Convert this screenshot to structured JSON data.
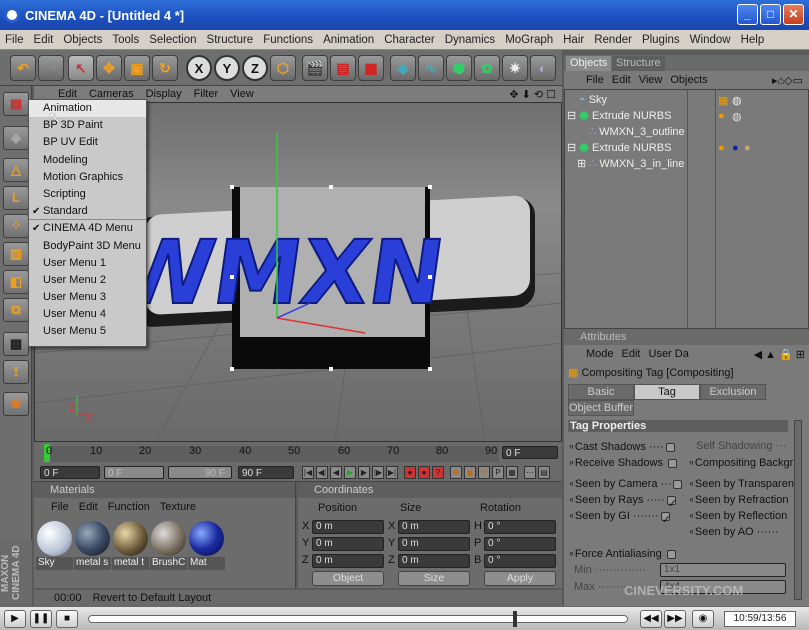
{
  "window": {
    "title": "CINEMA 4D - [Untitled 4 *]",
    "min": "_",
    "max": "□",
    "close": "✕"
  },
  "menubar": [
    "File",
    "Edit",
    "Objects",
    "Tools",
    "Selection",
    "Structure",
    "Functions",
    "Animation",
    "Character",
    "Dynamics",
    "MoGraph",
    "Hair",
    "Render",
    "Plugins",
    "Window",
    "Help"
  ],
  "viewport_menu": [
    "Edit",
    "Cameras",
    "Display",
    "Filter",
    "View"
  ],
  "viewport_nav": "✥ ⬇ ⟲ ☐",
  "dropdown": {
    "items": [
      {
        "label": "Animation",
        "checked": false,
        "highlighted": true
      },
      {
        "label": "BP 3D Paint",
        "checked": false
      },
      {
        "label": "BP UV Edit",
        "checked": false
      },
      {
        "label": "Modeling",
        "checked": false
      },
      {
        "label": "Motion Graphics",
        "checked": false
      },
      {
        "label": "Scripting",
        "checked": false
      },
      {
        "label": "Standard",
        "checked": true,
        "separator": true
      },
      {
        "label": "CINEMA 4D Menu",
        "checked": true
      },
      {
        "label": "BodyPaint 3D Menu",
        "checked": false
      },
      {
        "label": "User Menu 1",
        "checked": false
      },
      {
        "label": "User Menu 2",
        "checked": false
      },
      {
        "label": "User Menu 3",
        "checked": false
      },
      {
        "label": "User Menu 4",
        "checked": false
      },
      {
        "label": "User Menu 5",
        "checked": false
      }
    ]
  },
  "scene": {
    "logo_text": "WMXN"
  },
  "timeline": {
    "ticks": [
      "0",
      "10",
      "20",
      "30",
      "40",
      "50",
      "60",
      "70",
      "80",
      "90"
    ],
    "current": "0 F",
    "start": "0 F",
    "preview_start": "0 F",
    "preview_end": "90 F",
    "end": "90 F"
  },
  "materials": {
    "header": "Materials",
    "menu": [
      "File",
      "Edit",
      "Function",
      "Texture"
    ],
    "items": [
      {
        "label": "Sky",
        "color": "#dfe6f0"
      },
      {
        "label": "metal s",
        "color": "#3b4b66"
      },
      {
        "label": "metal t",
        "color": "#6a5a3a"
      },
      {
        "label": "BrushC",
        "color": "#7a7060"
      },
      {
        "label": "Mat",
        "color": "#1a2aa0"
      }
    ]
  },
  "coordinates": {
    "header": "Coordinates",
    "columns": [
      "Position",
      "Size",
      "Rotation"
    ],
    "rows": [
      {
        "axis": "X",
        "pos": "0 m",
        "size": "0 m",
        "rot_axis": "H",
        "rot": "0 °"
      },
      {
        "axis": "Y",
        "pos": "0 m",
        "size": "0 m",
        "rot_axis": "P",
        "rot": "0 °"
      },
      {
        "axis": "Z",
        "pos": "0 m",
        "size": "0 m",
        "rot_axis": "B",
        "rot": "0 °"
      }
    ],
    "mode1": "Object",
    "mode2": "Size",
    "apply": "Apply"
  },
  "status": {
    "time": "00:00",
    "message": "Revert to Default Layout"
  },
  "maxon": "MAXON CINEMA 4D",
  "objects": {
    "tabs": [
      "Objects",
      "Structure"
    ],
    "menu": [
      "File",
      "Edit",
      "View",
      "Objects"
    ],
    "rows": [
      {
        "name": "Sky",
        "indent": 0
      },
      {
        "name": "Extrude NURBS",
        "indent": 0
      },
      {
        "name": "WMXN_3_outline",
        "indent": 1
      },
      {
        "name": "Extrude NURBS",
        "indent": 0
      },
      {
        "name": "WMXN_3_in_line",
        "indent": 1
      }
    ]
  },
  "attributes": {
    "header": "Attributes",
    "menu": [
      "Mode",
      "Edit",
      "User Da"
    ],
    "title": "Compositing Tag [Compositing]",
    "tabs": [
      "Basic",
      "Tag",
      "Exclusion",
      "Object Buffer"
    ],
    "section": "Tag Properties",
    "left": [
      "Cast Shadows",
      "Receive Shadows",
      "Seen by Camera",
      "Seen by Rays",
      "Seen by GI",
      "Force Antialiasing",
      "Min",
      "Max"
    ],
    "right": [
      "Self Shadowing",
      "Compositing Backgr",
      "Seen by Transparen",
      "Seen by Refraction",
      "Seen by Reflection",
      "Seen by AO"
    ],
    "min_val": "1x1",
    "max_val": "4x4"
  },
  "player": {
    "time": "10:59/13:56",
    "watermark": "CINEVERSITY.COM"
  }
}
